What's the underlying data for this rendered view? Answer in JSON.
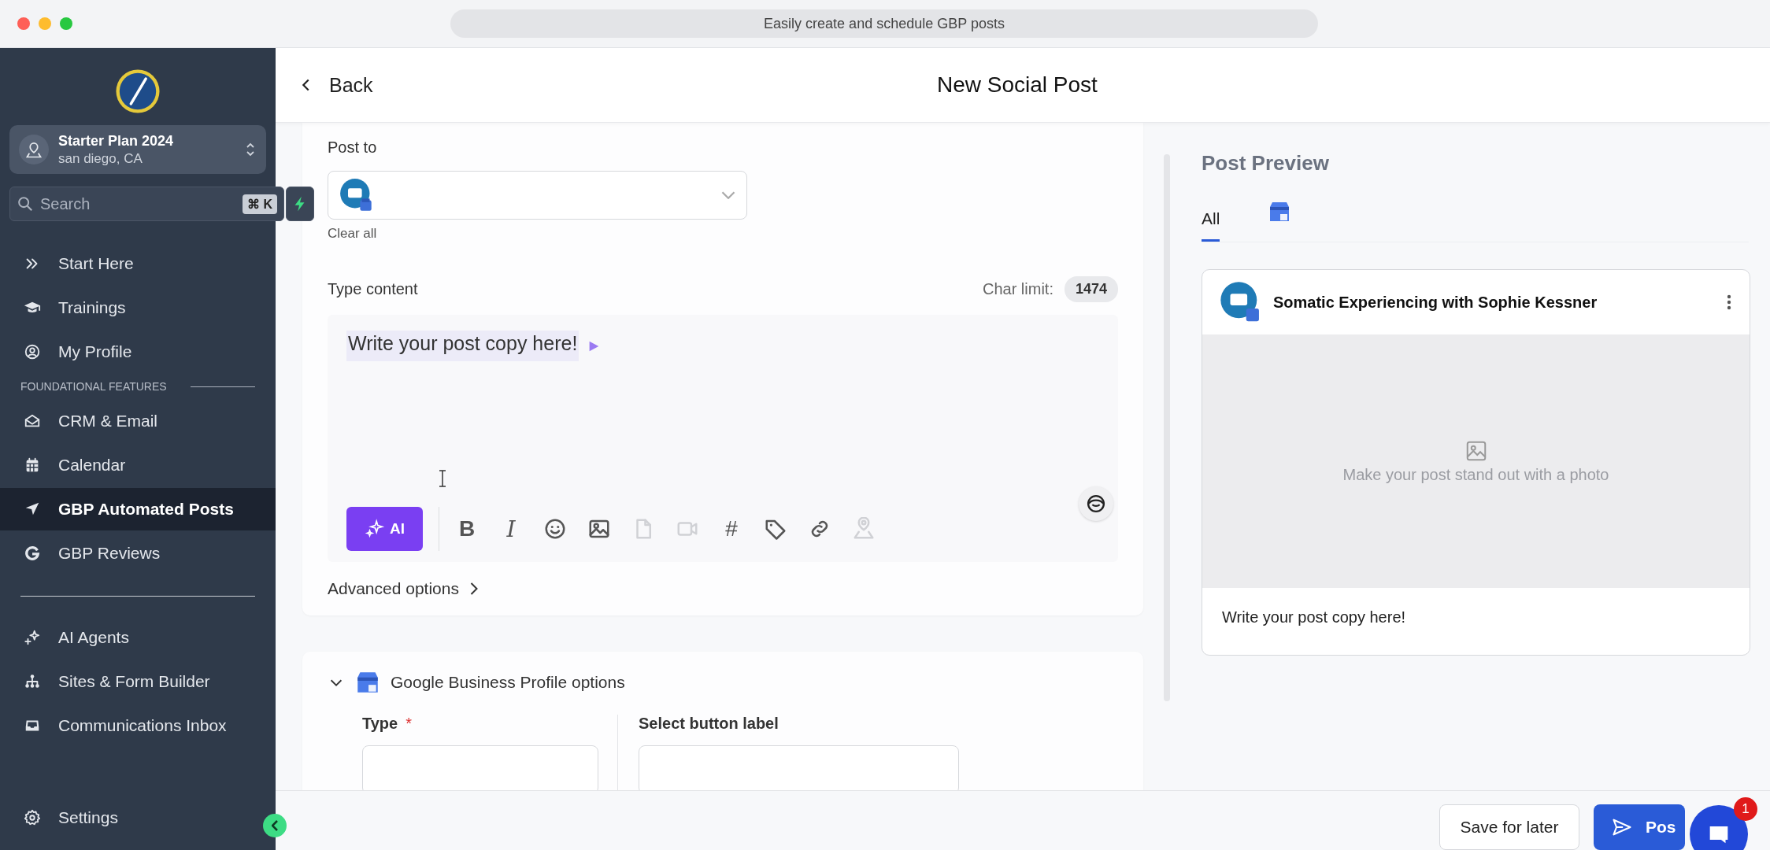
{
  "window": {
    "title": "Easily create and schedule GBP posts"
  },
  "sidebar": {
    "account": {
      "name": "Starter Plan 2024",
      "location": "san diego, CA"
    },
    "search": {
      "placeholder": "Search",
      "shortcut": "⌘ K"
    },
    "groups": [
      {
        "items": [
          {
            "label": "Start Here",
            "selected": false
          },
          {
            "label": "Trainings",
            "selected": false
          },
          {
            "label": "My Profile",
            "selected": false
          }
        ]
      },
      {
        "heading": "FOUNDATIONAL FEATURES",
        "items": [
          {
            "label": "CRM & Email",
            "selected": false
          },
          {
            "label": "Calendar",
            "selected": false
          },
          {
            "label": "GBP Automated Posts",
            "selected": true
          },
          {
            "label": "GBP Reviews",
            "selected": false
          }
        ]
      },
      {
        "items": [
          {
            "label": "AI Agents",
            "selected": false
          },
          {
            "label": "Sites & Form Builder",
            "selected": false
          },
          {
            "label": "Communications Inbox",
            "selected": false
          }
        ]
      }
    ],
    "settings": "Settings"
  },
  "header": {
    "back": "Back",
    "title": "New Social Post"
  },
  "editor": {
    "post_to_label": "Post to",
    "clear_all": "Clear all",
    "content_label": "Type content",
    "char_limit_label": "Char limit:",
    "char_limit": "1474",
    "content": "Write your post copy here!",
    "ai_button": "AI",
    "toolbar": [
      {
        "kind": "bold",
        "glyph": "B",
        "disabled": false
      },
      {
        "kind": "italic",
        "glyph": "I",
        "disabled": false
      },
      {
        "kind": "emoji",
        "disabled": false
      },
      {
        "kind": "image",
        "disabled": false
      },
      {
        "kind": "file",
        "disabled": true
      },
      {
        "kind": "video",
        "disabled": true
      },
      {
        "kind": "hashtag",
        "glyph": "#",
        "disabled": false
      },
      {
        "kind": "tag",
        "disabled": false
      },
      {
        "kind": "link",
        "disabled": false
      },
      {
        "kind": "location",
        "disabled": true
      }
    ],
    "advanced": "Advanced options"
  },
  "gbp_options": {
    "title": "Google Business Profile options",
    "expanded": true,
    "type_label": "Type",
    "required_mark": "*",
    "button_label": "Select button label"
  },
  "preview": {
    "title": "Post Preview",
    "tabs": [
      {
        "kind": "text",
        "label": "All",
        "selected": true
      },
      {
        "kind": "gbp",
        "selected": false
      }
    ],
    "card": {
      "name": "Somatic Experiencing with Sophie Kessner",
      "photo_hint": "Make your post stand out with a photo",
      "text": "Write your post copy here!"
    }
  },
  "footer": {
    "save": "Save for later",
    "post": "Pos",
    "chat_badge": "1"
  }
}
